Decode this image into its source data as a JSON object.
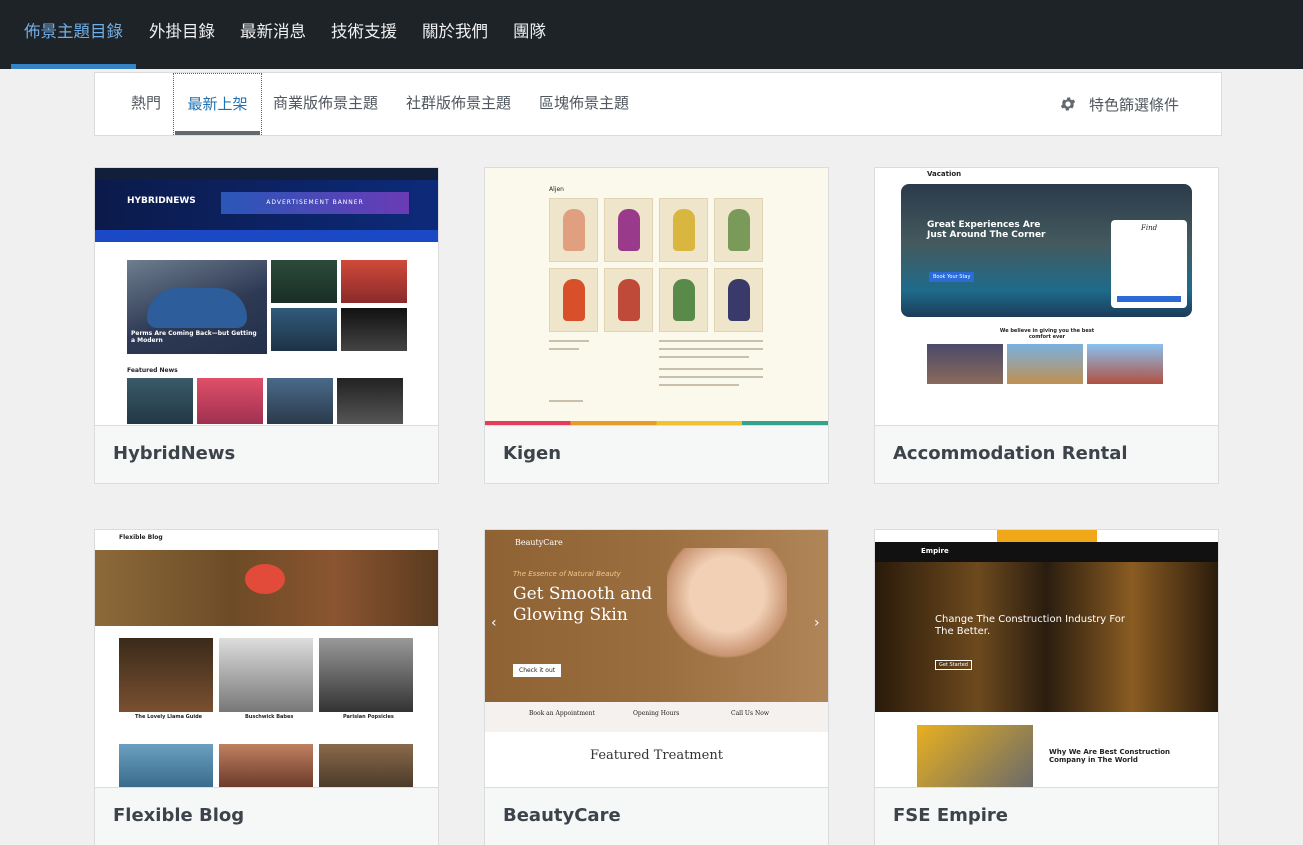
{
  "topnav": {
    "items": [
      {
        "label": "佈景主題目錄"
      },
      {
        "label": "外掛目錄"
      },
      {
        "label": "最新消息"
      },
      {
        "label": "技術支援"
      },
      {
        "label": "關於我們"
      },
      {
        "label": "團隊"
      }
    ]
  },
  "filter": {
    "tabs": [
      {
        "label": "熱門"
      },
      {
        "label": "最新上架"
      },
      {
        "label": "商業版佈景主題"
      },
      {
        "label": "社群版佈景主題"
      },
      {
        "label": "區塊佈景主題"
      }
    ],
    "feature_filter_label": "特色篩選條件",
    "icon": "gear-icon"
  },
  "themes": [
    {
      "name": "HybridNews",
      "shot": {
        "logo": "HYBRIDNEWS",
        "ad": "ADVERTISEMENT BANNER",
        "headline": "Perms Are Coming Back—but Getting a Modern",
        "section": "Featured News"
      }
    },
    {
      "name": "Kigen",
      "shot": {
        "heading": "Aljen"
      }
    },
    {
      "name": "Accommodation Rental",
      "shot": {
        "brand": "Vacation",
        "hero_title": "Great Experiences Are Just Around The Corner",
        "form_title": "Find",
        "cta": "Book Your Stay",
        "section": "We believe in giving you the best comfort ever"
      }
    },
    {
      "name": "Flexible Blog",
      "shot": {
        "brand": "Flexible Blog",
        "posts": [
          "The Lovely Llama Guide",
          "Buschwick Babes",
          "Parisian Popsicles"
        ]
      }
    },
    {
      "name": "BeautyCare",
      "shot": {
        "brand": "BeautyCare",
        "kicker": "The Essence of Natural Beauty",
        "headline": "Get Smooth and Glowing Skin",
        "cta": "Check it out",
        "bar": [
          "Book an Appointment",
          "Opening Hours",
          "Call Us Now"
        ],
        "section": "Featured Treatment"
      }
    },
    {
      "name": "FSE Empire",
      "shot": {
        "brand": "Empire",
        "headline": "Change The Construction Industry For The Better.",
        "cta": "Get Started",
        "section": "Why We Are Best Construction Company in The World"
      }
    }
  ],
  "colors": {
    "nav_bg": "#1d2327",
    "accent": "#72aee6",
    "card_bg": "#ffffff",
    "page_bg": "#f0f0f1"
  }
}
